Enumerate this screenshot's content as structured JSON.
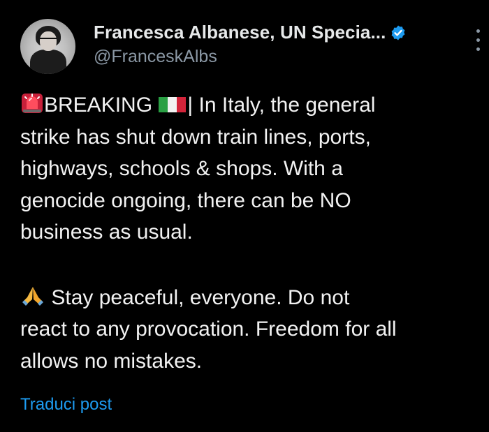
{
  "author": {
    "display_name": "Francesca Albanese, UN Specia...",
    "handle": "@FranceskAlbs",
    "verified": true
  },
  "tweet": {
    "paragraph1": {
      "line1_word1": "BREAKING",
      "line1_rest": "| In Italy, the general",
      "line2": "strike has shut down train lines, ports,",
      "line3": "highways, schools & shops. With a",
      "line4": "genocide ongoing, there can be NO",
      "line5": "business as usual."
    },
    "paragraph2": {
      "line1": "Stay peaceful, everyone. Do not",
      "line2": "react to any provocation. Freedom for all",
      "line3": "allows no mistakes."
    },
    "emojis": [
      "rotating-light-icon",
      "italy-flag-icon",
      "folded-hands-icon"
    ]
  },
  "actions": {
    "translate_label": "Traduci post"
  },
  "colors": {
    "background": "#000000",
    "text": "#e7e9ea",
    "secondary": "#8b98a5",
    "accent": "#1d9bf0"
  }
}
